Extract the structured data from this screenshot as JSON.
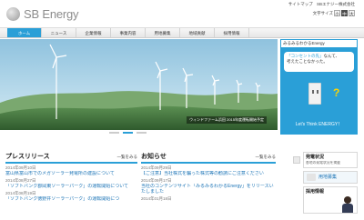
{
  "header": {
    "logo_text": "SB Energy",
    "util_links": [
      "サイトマップ",
      "SBエナジー株式会社"
    ],
    "font_size_label": "文字サイズ",
    "font_size_options": [
      "小",
      "中",
      "大"
    ],
    "font_size_selected": "中"
  },
  "nav": {
    "items": [
      {
        "label": "ホーム",
        "active": true
      },
      {
        "label": "ニュース",
        "active": false
      },
      {
        "label": "企業情報",
        "active": false
      },
      {
        "label": "事業内容",
        "active": false
      },
      {
        "label": "用地募集",
        "active": false
      },
      {
        "label": "地域貢献",
        "active": false
      },
      {
        "label": "採用情報",
        "active": false
      }
    ]
  },
  "hero": {
    "caption": "ウィンドファーム浜田 2015年度運転開始予定",
    "slides_count": 3,
    "active_slide": 2
  },
  "side_ad": {
    "header": "みるみるわかるEnergy",
    "bubble_line1_accent": "「コンセントの先」",
    "bubble_line1_rest": "なんて、",
    "bubble_line2": "考えたことなかった。",
    "footer": "Let's Think ENERGY！"
  },
  "press": {
    "title": "プレスリリース",
    "more": "一覧をみる",
    "items": [
      {
        "date": "2014年09月10日",
        "title": "富山県富山市でのメガソーラー発電所の建設について"
      },
      {
        "date": "2014年08月27日",
        "title": "「ソフトバンク郡岡東ソーラーパーク」の運転開始について"
      },
      {
        "date": "2014年08月19日",
        "title": "「ソフトバンク徳野井ソーラーパーク」の運転開始につ"
      }
    ]
  },
  "info": {
    "title": "お知らせ",
    "more": "一覧をみる",
    "items": [
      {
        "date": "2014年09月29日",
        "title": "【ご注意】当社株式を騙った株式等の勧誘にご注意ください"
      },
      {
        "date": "2014年09月17日",
        "title": "当社のコンテンツサイト「みるみるわかるEnergy」をリリースいたしました"
      },
      {
        "date": "2014年01月18日",
        "title": ""
      }
    ]
  },
  "right_col": {
    "generation_title": "発電状況",
    "generation_sub": "各地の発電状況を掲載",
    "banner": "用地募集",
    "recruit_title": "採用情報"
  },
  "colors": {
    "accent": "#2a9fd7",
    "link": "#1a73b6",
    "nav_bg": "#e6e6e6"
  }
}
